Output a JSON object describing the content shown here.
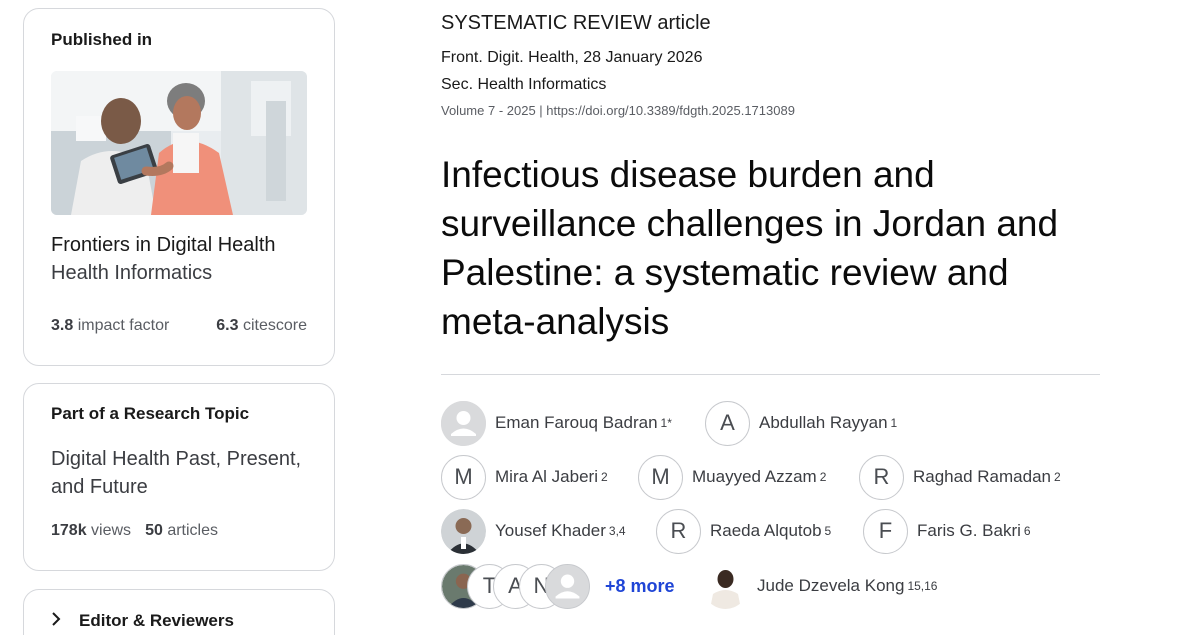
{
  "sidebar": {
    "published": {
      "title": "Published in",
      "journal_name": "Frontiers in Digital Health",
      "section_name": "Health Informatics",
      "impact_value": "3.8",
      "impact_label": "impact factor",
      "citescore_value": "6.3",
      "citescore_label": "citescore"
    },
    "topic": {
      "title": "Part of a Research Topic",
      "name": "Digital Health Past, Present, and Future",
      "views_value": "178k",
      "views_label": "views",
      "articles_value": "50",
      "articles_label": "articles"
    },
    "editors": {
      "label": "Editor & Reviewers",
      "icon": "chevron-right-icon"
    }
  },
  "article": {
    "type": "SYSTEMATIC REVIEW article",
    "journal_line": "Front. Digit. Health, 28 January 2026",
    "section_line": "Sec. Health Informatics",
    "volume_line": "Volume 7 - 2025 | https://doi.org/10.3389/fdgth.2025.1713089",
    "title": "Infectious disease burden and surveillance challenges in Jordan and Palestine: a systematic review and meta-analysis"
  },
  "authors": [
    {
      "name": "Eman Farouq Badran",
      "aff": "1*",
      "avatar": "person-icon"
    },
    {
      "name": "Abdullah Rayyan",
      "aff": "1",
      "avatar": "A"
    },
    {
      "name": "Mira Al Jaberi",
      "aff": "2",
      "avatar": "M"
    },
    {
      "name": "Muayyed Azzam",
      "aff": "2",
      "avatar": "M"
    },
    {
      "name": "Raghad Ramadan",
      "aff": "2",
      "avatar": "R"
    },
    {
      "name": "Yousef Khader",
      "aff": "3,4",
      "avatar": "photo"
    },
    {
      "name": "Raeda Alqutob",
      "aff": "5",
      "avatar": "R"
    },
    {
      "name": "Faris G. Bakri",
      "aff": "6",
      "avatar": "F"
    },
    {
      "name": "Jude Dzevela Kong",
      "aff": "15,16",
      "avatar": "photo"
    }
  ],
  "stack": {
    "initials": [
      "T",
      "A",
      "N"
    ],
    "more_label": "+8 more"
  },
  "colors": {
    "accent_link": "#1f45d6",
    "border": "#d6d8dc",
    "text_muted": "#5a5d63"
  }
}
